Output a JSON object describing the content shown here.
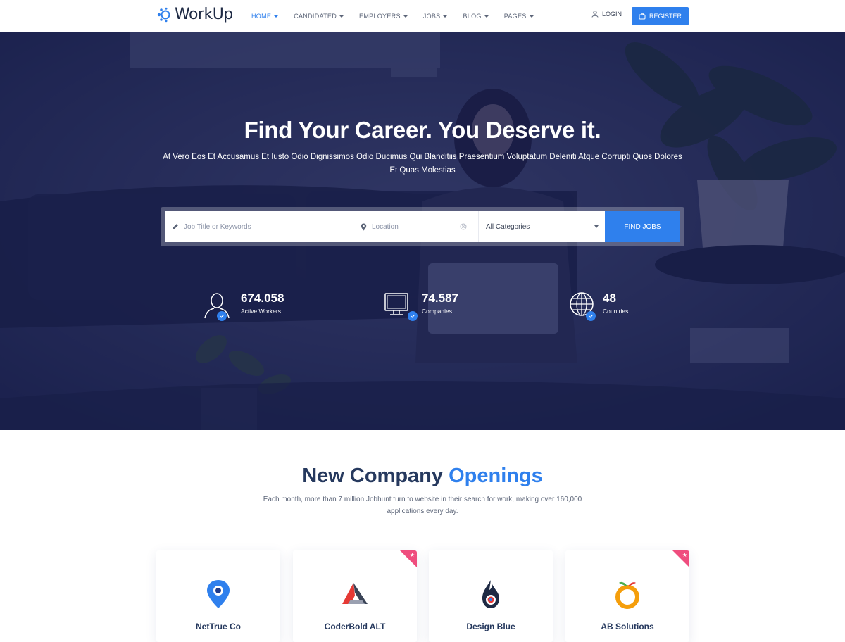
{
  "header": {
    "logo_text": "WorkUp",
    "nav": [
      {
        "label": "HOME",
        "active": true
      },
      {
        "label": "CANDIDATED",
        "active": false
      },
      {
        "label": "EMPLOYERS",
        "active": false
      },
      {
        "label": "JOBS",
        "active": false
      },
      {
        "label": "BLOG",
        "active": false
      },
      {
        "label": "PAGES",
        "active": false
      }
    ],
    "login_label": "LOGIN",
    "register_label": "REGISTER"
  },
  "hero": {
    "title": "Find Your Career. You Deserve it.",
    "subtitle": "At Vero Eos Et Accusamus Et Iusto Odio Dignissimos  Odio  Ducimus Qui Blanditiis Praesentium Voluptatum Deleniti Atque Corrupti Quos Dolores Et Quas Molestias",
    "search": {
      "keywords_placeholder": "Job Title or Keywords",
      "location_placeholder": "Location",
      "category_selected": "All Categories",
      "button_label": "FIND JOBS"
    },
    "stats": [
      {
        "value": "674.058",
        "label": "Active Workers",
        "icon": "user-icon"
      },
      {
        "value": "74.587",
        "label": "Companies",
        "icon": "monitor-icon"
      },
      {
        "value": "48",
        "label": "Countries",
        "icon": "globe-icon"
      }
    ]
  },
  "openings": {
    "title_part1": "New Company",
    "title_part2": "Openings",
    "description": "Each month, more than 7 million Jobhunt turn to website in their search for work, making over 160,000 applications every day.",
    "companies": [
      {
        "name": "NetTrue Co",
        "featured": false
      },
      {
        "name": "CoderBold ALT",
        "featured": true
      },
      {
        "name": "Design Blue",
        "featured": false
      },
      {
        "name": "AB Solutions",
        "featured": true
      }
    ]
  },
  "colors": {
    "accent": "#2f80ed",
    "heading": "#26395e",
    "featured_ribbon": "#ef4d7e"
  }
}
